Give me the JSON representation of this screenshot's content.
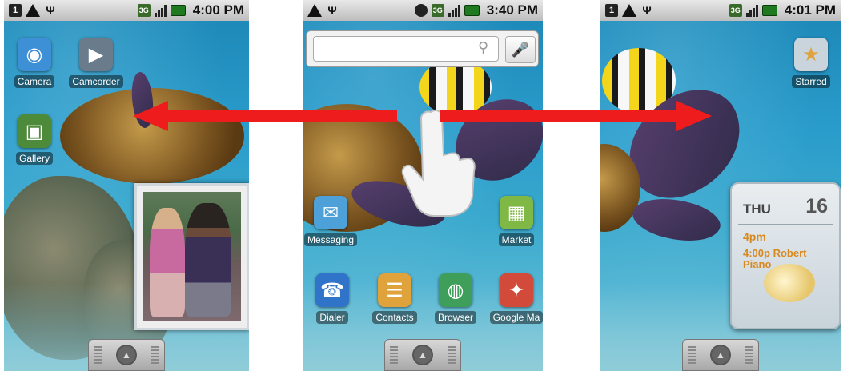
{
  "screens": [
    {
      "status_time": "4:00 PM",
      "apps": [
        {
          "label": "Camera",
          "icon": "camera-icon",
          "color": "#3d8fd6",
          "glyph": "◉"
        },
        {
          "label": "Camcorder",
          "icon": "camcorder-icon",
          "color": "#6a7b8c",
          "glyph": "▶"
        },
        {
          "label": "Gallery",
          "icon": "gallery-icon",
          "color": "#4d8a3a",
          "glyph": "▣"
        }
      ],
      "widget": "photo-frame"
    },
    {
      "status_time": "3:40 PM",
      "search_placeholder": "",
      "apps": [
        {
          "label": "Messaging",
          "icon": "messaging-icon",
          "color": "#4da0d8",
          "glyph": "✉"
        },
        {
          "label": "Market",
          "icon": "market-icon",
          "color": "#7fb844",
          "glyph": "▦"
        },
        {
          "label": "Dialer",
          "icon": "dialer-icon",
          "color": "#2f74c8",
          "glyph": "☎"
        },
        {
          "label": "Contacts",
          "icon": "contacts-icon",
          "color": "#e0a23a",
          "glyph": "☰"
        },
        {
          "label": "Browser",
          "icon": "browser-icon",
          "color": "#3f9f5a",
          "glyph": "◍"
        },
        {
          "label": "Google Ma",
          "icon": "maps-icon",
          "color": "#d24b3a",
          "glyph": "✦"
        }
      ]
    },
    {
      "status_time": "4:01 PM",
      "apps": [
        {
          "label": "Starred",
          "icon": "starred-contact-icon",
          "color": "#c9d4dc",
          "glyph": "★"
        }
      ],
      "calendar": {
        "day": "THU",
        "date": "16",
        "time": "4pm",
        "event": "4:00p Robert Piano"
      }
    }
  ],
  "colors": {
    "arrow": "#ee1c1c",
    "event_text": "#d8891e"
  }
}
